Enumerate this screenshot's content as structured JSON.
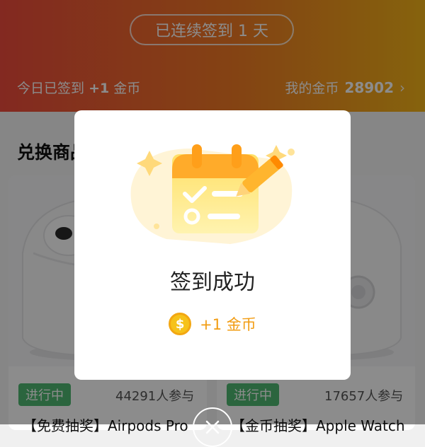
{
  "header": {
    "streak_label": "已连续签到 1 天",
    "today_prefix": "今日已签到",
    "today_reward": "+1",
    "today_unit": "金币",
    "mycoins_label": "我的金币",
    "mycoins_value": "28902"
  },
  "section": {
    "title": "兑换商品"
  },
  "cards": [
    {
      "status": "进行中",
      "participants": "44291人参与",
      "title": "【免费抽奖】Airpods Pro"
    },
    {
      "status": "进行中",
      "participants": "17657人参与",
      "title": "【金币抽奖】Apple Watch"
    }
  ],
  "modal": {
    "title": "签到成功",
    "reward_text": "+1 金币",
    "coin_symbol": "$"
  },
  "colors": {
    "accent_orange": "#f29c12",
    "header_red": "#ef4b3c",
    "status_green": "#4fb872"
  }
}
